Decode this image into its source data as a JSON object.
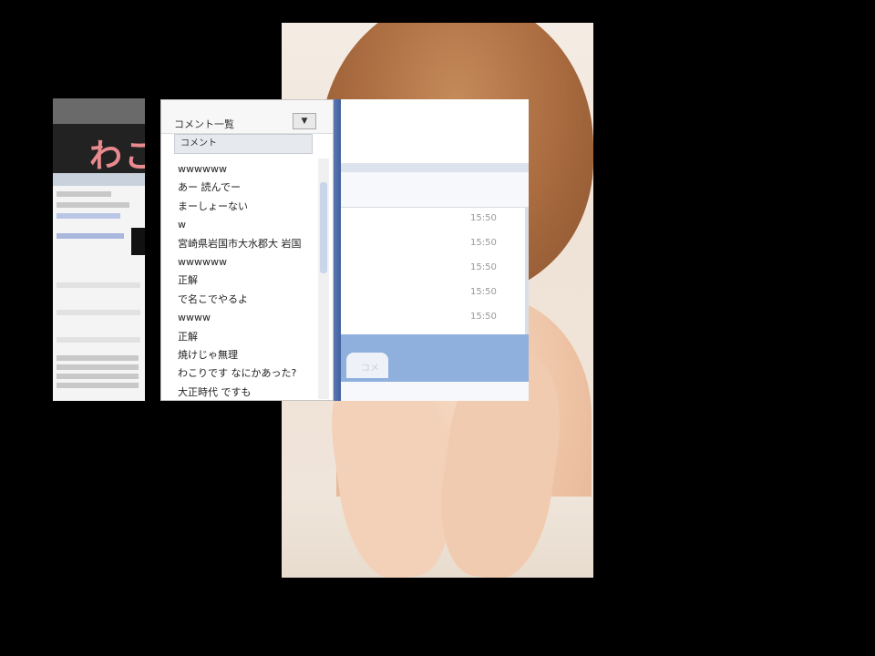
{
  "left_window": {
    "logo_text": "わこ"
  },
  "comment_window": {
    "title": "コメント一覧",
    "menu_button": "▼",
    "column_header": "コメント",
    "comments": [
      "wwwwww",
      "あー 読んでー",
      "まーしょーない",
      "w",
      "宮崎県岩国市大水郡大 岩国",
      "wwwwww",
      "正解",
      "で名こでやるよ",
      "wwww",
      "正解",
      "焼けじゃ無理",
      "わこりです なにかあった?",
      "大正時代 ですも"
    ]
  },
  "right_panel": {
    "times": [
      "15:50",
      "15:50",
      "15:50",
      "15:50",
      "15:50"
    ],
    "footer_tab": "コメ"
  },
  "colors": {
    "accent_blue": "#4a6aa9",
    "logo_pink": "#e98a8f",
    "footer_blue": "#8fb0dc"
  }
}
